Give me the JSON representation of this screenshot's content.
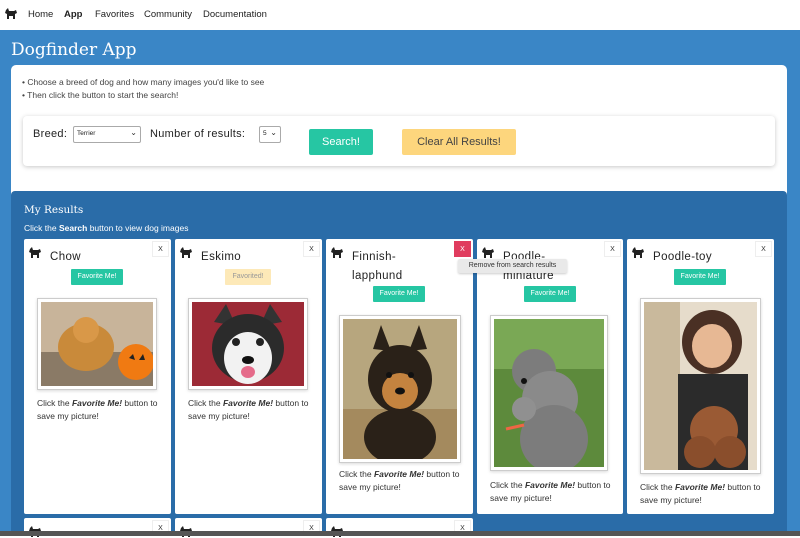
{
  "nav": {
    "logo_icon": "dog-icon",
    "links": [
      {
        "label": "Home",
        "active": false
      },
      {
        "label": "App",
        "active": true
      },
      {
        "label": "Favorites",
        "active": false
      },
      {
        "label": "Community",
        "active": false
      },
      {
        "label": "Documentation",
        "active": false
      }
    ]
  },
  "app": {
    "title": "Dogfinder App",
    "instructions": [
      "• Choose a breed of dog and how many images you'd like to see",
      "• Then click the button to start the search!"
    ],
    "search": {
      "breed_label": "Breed:",
      "breed_value": "Terrier",
      "count_label": "Number of results:",
      "count_value": "5",
      "search_button": "Search!",
      "clear_button": "Clear All Results!"
    }
  },
  "results": {
    "title": "My Results",
    "hint_prefix": "Click the ",
    "hint_bold": "Search",
    "hint_suffix": " button to view dog images",
    "tooltip": "Remove from search results",
    "close_label": "X",
    "caption_prefix": "Click the ",
    "caption_em": "Favorite Me!",
    "caption_suffix": " button to save my picture!",
    "cards": [
      {
        "name": "Chow",
        "fav_label": "Favorite Me!",
        "favorited": false
      },
      {
        "name": "Eskimo",
        "fav_label": "Favorited!",
        "favorited": true
      },
      {
        "name": "Finnish-lapphund",
        "fav_label": "Favorite Me!",
        "favorited": false
      },
      {
        "name": "Poodle-miniature",
        "fav_label": "Favorite Me!",
        "favorited": false
      },
      {
        "name": "Poodle-toy",
        "fav_label": "Favorite Me!",
        "favorited": false
      }
    ]
  },
  "colors": {
    "page_bg": "#3a86c6",
    "results_bg": "#2a6ca8",
    "accent_green": "#26c6a3",
    "clear_yellow": "#fdd67d",
    "remove_red": "#e03c5e"
  }
}
